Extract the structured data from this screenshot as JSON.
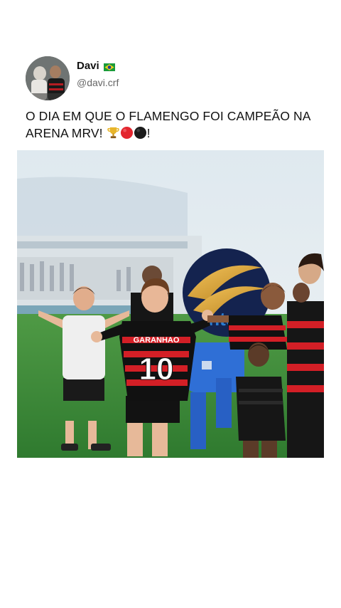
{
  "tweet": {
    "author_name": "Davi",
    "author_flag": "brazil-flag-icon",
    "handle": "@davi.crf",
    "text_main": "O DIA EM QUE O FLAMENGO FOI CAMPEÃO NA ARENA MRV! ",
    "text_end": "!",
    "emojis": [
      "trophy-icon",
      "red-circle-icon",
      "black-circle-icon"
    ]
  },
  "media": {
    "jersey_name": "GARANHAO",
    "jersey_number": "10",
    "colors": {
      "flamengo_red": "#d31f26",
      "jersey_black": "#111111",
      "pitch_green": "#3f8a3a",
      "goalkeeper_blue": "#2f6fd6",
      "sky": "#dde7ee"
    }
  }
}
